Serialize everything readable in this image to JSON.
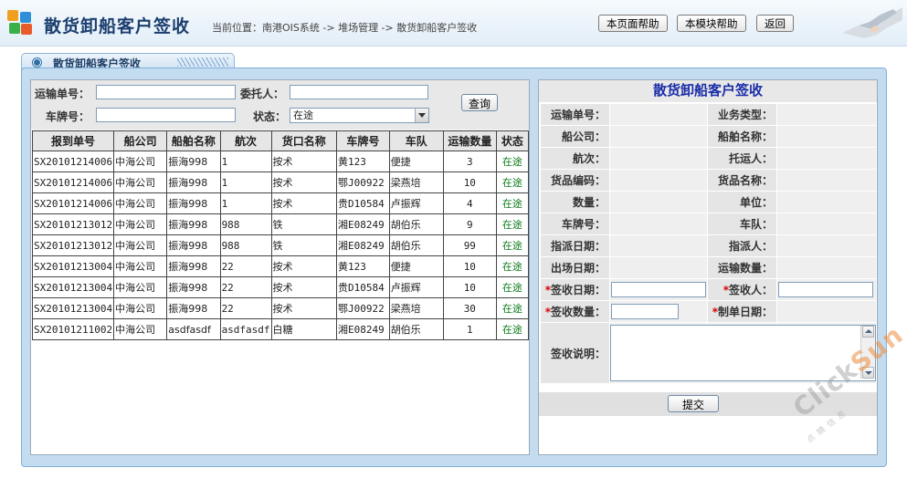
{
  "header": {
    "title": "散货卸船客户签收",
    "breadcrumb": "当前位置：南港OIS系统 -> 堆场管理 -> 散货卸船客户签收",
    "buttons": {
      "page_help": "本页面帮助",
      "module_help": "本模块帮助",
      "back": "返回"
    }
  },
  "tab": {
    "label": "散货卸船客户签收"
  },
  "search": {
    "transport_no_label": "运输单号：",
    "transport_no_value": "",
    "consignor_label": "委托人：",
    "consignor_value": "",
    "plate_label": "车牌号：",
    "plate_value": "",
    "status_label": "状态：",
    "status_value": "在途",
    "query_button": "查询"
  },
  "table": {
    "headers": [
      "报到单号",
      "船公司",
      "船舶名称",
      "航次",
      "货口名称",
      "车牌号",
      "车队",
      "运输数量",
      "状态"
    ],
    "rows": [
      [
        "SX20101214006",
        "中海公司",
        "振海998",
        "1",
        "按术",
        "黄123",
        "便捷",
        "3",
        "在途"
      ],
      [
        "SX20101214006",
        "中海公司",
        "振海998",
        "1",
        "按术",
        "鄂J00922",
        "梁燕培",
        "10",
        "在途"
      ],
      [
        "SX20101214006",
        "中海公司",
        "振海998",
        "1",
        "按术",
        "贵D10584",
        "卢振辉",
        "4",
        "在途"
      ],
      [
        "SX20101213012",
        "中海公司",
        "振海998",
        "988",
        "铁",
        "湘E08249",
        "胡伯乐",
        "9",
        "在途"
      ],
      [
        "SX20101213012",
        "中海公司",
        "振海998",
        "988",
        "铁",
        "湘E08249",
        "胡伯乐",
        "99",
        "在途"
      ],
      [
        "SX20101213004",
        "中海公司",
        "振海998",
        "22",
        "按术",
        "黄123",
        "便捷",
        "10",
        "在途"
      ],
      [
        "SX20101213004",
        "中海公司",
        "振海998",
        "22",
        "按术",
        "贵D10584",
        "卢振辉",
        "10",
        "在途"
      ],
      [
        "SX20101213004",
        "中海公司",
        "振海998",
        "22",
        "按术",
        "鄂J00922",
        "梁燕培",
        "30",
        "在途"
      ],
      [
        "SX20101211002",
        "中海公司",
        "asdfasdf",
        "asdfasdf",
        "白糖",
        "湘E08249",
        "胡伯乐",
        "1",
        "在途"
      ]
    ]
  },
  "form": {
    "title": "散货卸船客户签收",
    "rows": [
      [
        {
          "label": "运输单号："
        },
        {
          "label": "业务类型："
        }
      ],
      [
        {
          "label": "船公司："
        },
        {
          "label": "船舶名称："
        }
      ],
      [
        {
          "label": "航次："
        },
        {
          "label": "托运人："
        }
      ],
      [
        {
          "label": "货品编码："
        },
        {
          "label": "货品名称："
        }
      ],
      [
        {
          "label": "数量："
        },
        {
          "label": "单位："
        }
      ],
      [
        {
          "label": "车牌号："
        },
        {
          "label": "车队："
        }
      ],
      [
        {
          "label": "指派日期："
        },
        {
          "label": "指派人："
        }
      ],
      [
        {
          "label": "出场日期："
        },
        {
          "label": "运输数量："
        }
      ]
    ],
    "required_mark": "*",
    "sign_date_label": "签收日期：",
    "signer_label": "签收人：",
    "sign_qty_label": "签收数量：",
    "make_date_label": "制单日期：",
    "sign_note_label": "签收说明：",
    "submit_button": "提交"
  },
  "watermark": {
    "brand": "ClickSun",
    "brand_part1": "Click",
    "brand_part2": "Sun",
    "sub": "点睛信息"
  },
  "colors": {
    "title_blue": "#1b3e6e",
    "form_title": "#1a2da8",
    "status_green": "#0c7a1a",
    "required_red": "#dd0000",
    "panel_blue": "#c4dcf0"
  }
}
